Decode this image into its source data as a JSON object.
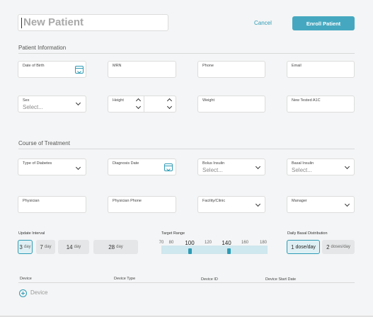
{
  "header": {
    "patient_name_placeholder": "New Patient",
    "cancel_label": "Cancel",
    "enroll_label": "Enroll Patient"
  },
  "sections": {
    "patient_info": "Patient Information",
    "course": "Course of Treatment"
  },
  "patient_fields": {
    "dob": "Date of Birth",
    "mrn": "MRN",
    "phone": "Phone",
    "email": "Email",
    "sex": "Sex",
    "sex_value": "Select...",
    "height": "Height",
    "weight": "Weight",
    "a1c": "New Tested A1C"
  },
  "course_fields": {
    "diabetes_type": "Type of Diabetes",
    "diagnosis_date": "Diagnosis Date",
    "bolus": "Bolus Insulin",
    "bolus_value": "Select...",
    "basal": "Basal Insulin",
    "basal_value": "Select...",
    "physician": "Physician",
    "physician_phone": "Physician Phone",
    "facility": "Facility/Clinic",
    "manager": "Manager"
  },
  "update_interval": {
    "label": "Update Interval",
    "options": [
      {
        "num": "3",
        "unit": "day",
        "selected": true
      },
      {
        "num": "7",
        "unit": "day",
        "selected": false
      },
      {
        "num": "14",
        "unit": "day",
        "selected": false
      },
      {
        "num": "28",
        "unit": "day",
        "selected": false
      }
    ]
  },
  "target_range": {
    "label": "Target Range",
    "ticks": [
      "70",
      "80",
      "100",
      "120",
      "140",
      "160",
      "180"
    ],
    "low": 100,
    "high": 140
  },
  "basal_distribution": {
    "label": "Daily Basal Distribution",
    "options": [
      {
        "num": "1",
        "unit": "dose/day",
        "selected": true
      },
      {
        "num": "2",
        "unit": "doses/day",
        "selected": false
      }
    ]
  },
  "devices": {
    "columns": [
      "Device",
      "Device Type",
      "Device ID",
      "Device Start Date"
    ],
    "add_label": "Device"
  },
  "colors": {
    "accent": "#2e9bb5",
    "enroll_button": "#45a8c0",
    "background": "#f4f5f6"
  }
}
